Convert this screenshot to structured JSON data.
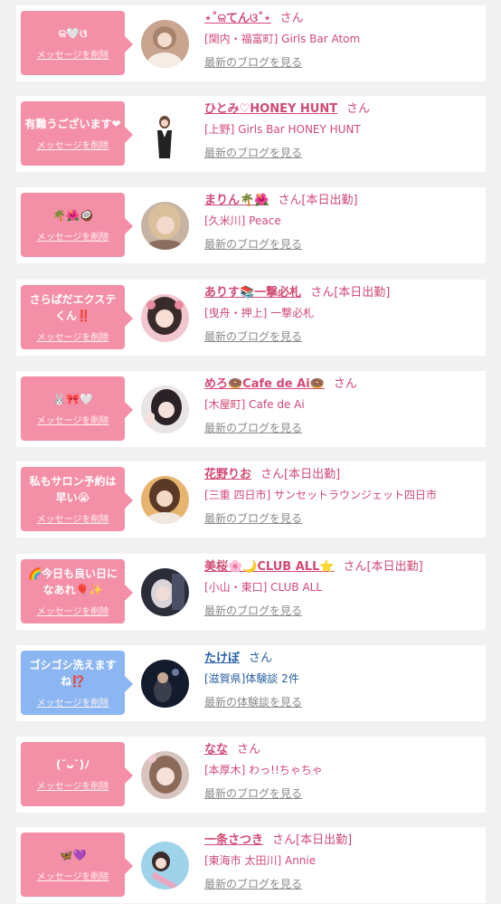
{
  "delete_label": "メッセージを削除",
  "colors": {
    "pink": "#f48fa8",
    "blue": "#8cb6f2",
    "name_pink": "#d14a73",
    "name_blue": "#2a5fa3"
  },
  "entries": [
    {
      "message": "ଳ🤍ଓ",
      "name": "⋆˚ଳてんଓ˚⋆",
      "suffix": "さん",
      "shop": "[関内・福富町] Girls Bar Atom",
      "link": "最新のブログを見る"
    },
    {
      "message": "有難うございます❤",
      "name": "ひとみ♡HONEY HUNT",
      "suffix": "さん",
      "shop": "[上野] Girls Bar HONEY HUNT",
      "link": "最新のブログを見る"
    },
    {
      "message": "🌴🌺🥥",
      "name": "まりん🌴🌺",
      "suffix": "さん[本日出勤]",
      "shop": "[久米川] Peace",
      "link": "最新のブログを見る"
    },
    {
      "message": "さらばだエクステくん‼️",
      "name": "ありす📚一撃必札",
      "suffix": "さん[本日出勤]",
      "shop": "[曳舟・押上] 一撃必札",
      "link": "最新のブログを見る"
    },
    {
      "message": "🐰🎀🤍",
      "name": "めろ🍩Cafe de Ai🍩",
      "suffix": "さん",
      "shop": "[木屋町] Cafe de Ai",
      "link": "最新のブログを見る"
    },
    {
      "message": "私もサロン予約は早い😭",
      "name": "花野りお",
      "suffix": "さん[本日出勤]",
      "shop": "[三重 四日市] サンセットラウンジェット四日市",
      "link": "最新のブログを見る"
    },
    {
      "message": "🌈今日も良い日になあれ🎈✨",
      "name": "美桜🌸🌙CLUB ALL⭐",
      "suffix": "さん[本日出勤]",
      "shop": "[小山・東口] CLUB ALL",
      "link": "最新のブログを見る"
    },
    {
      "message": "ゴシゴシ洗えますね⁉️",
      "name": "たけぼ",
      "suffix": "さん",
      "shop": "[滋賀県]体験談 2件",
      "link": "最新の体験談を見る"
    },
    {
      "message": "(˘ᴗ˘)ﾉ",
      "name": "なな",
      "suffix": "さん",
      "shop": "[本厚木] わっ!!ちゃちゃ",
      "link": "最新のブログを見る"
    },
    {
      "message": "🦋💜",
      "name": "一条さつき",
      "suffix": "さん[本日出勤]",
      "shop": "[東海市 太田川] Annie",
      "link": "最新のブログを見る"
    }
  ]
}
